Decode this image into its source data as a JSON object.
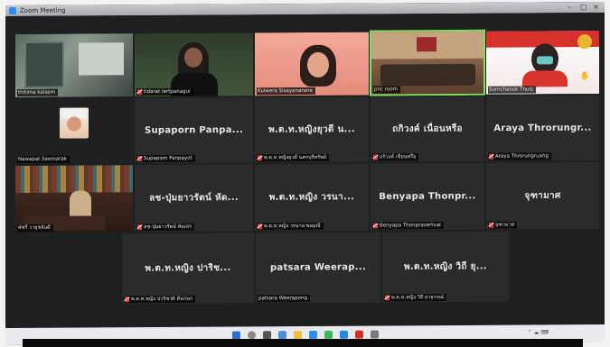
{
  "window": {
    "title": "Zoom Meeting"
  },
  "tiles": {
    "t1": {
      "label": "thitima kaisem"
    },
    "t2": {
      "label": "tidarat lertpanagul"
    },
    "t3": {
      "label": "Kulwera Sisayanarane"
    },
    "t4": {
      "label": "pnc room"
    },
    "t5": {
      "label": "Sornchanok Thuis"
    },
    "t6": {
      "label": "Nawapat Seemarak"
    },
    "t7": {
      "center": "Supaporn Panpa...",
      "label": "Supaporn Panpayot"
    },
    "t8": {
      "center": "พ.ต.ท.หญิงยุวดี น...",
      "label": "พ.ต.ท.หญิงยุวดี นครบุรีทรัพย์"
    },
    "t9": {
      "center": "ถกิวงค์ เนื่อนหรือ",
      "label": "ถกิวงค์ เขียนหรือ"
    },
    "t10": {
      "center": "Araya Throrungr...",
      "label": "Araya Throrungruang"
    },
    "t11": {
      "label": "พัชรี วายุชจันดี"
    },
    "t12": {
      "center": "ลช-ปุ่มยาวรัตน์ หัด...",
      "label": "ลช-ปุ่มยาวรัตน์ หัดเสร"
    },
    "t13": {
      "center": "พ.ต.ท.หญิง วรนา...",
      "label": "พ.ต.ท.หญิง วรนาล พลมณี"
    },
    "t14": {
      "center": "Benyapa Thonpr...",
      "label": "Benyapa Thonprasertvat"
    },
    "t15": {
      "center": "จุฑามาศ",
      "label": "จุฑามาศ"
    },
    "t16": {
      "center": "พ.ต.ท.หญิง ปาริช...",
      "label": "พ.ต.ท.หญิง ปาริชาติ ต้นกนก"
    },
    "t17": {
      "center": "patsara Weerap...",
      "label": "patsara Weerapong"
    },
    "t18": {
      "center": "พ.ต.ท.หญิง วิถี ยุ...",
      "label": "พ.ต.ท.หญิง วิถี ยาธกรณ์"
    }
  },
  "colors": {
    "active_speaker_border": "#7fe05a",
    "muted_mic": "#e0403a",
    "tile_bg": "#2a2b2d"
  },
  "icons": {
    "muted": "mic-muted-icon",
    "raise_hand": "raise-hand-icon"
  }
}
